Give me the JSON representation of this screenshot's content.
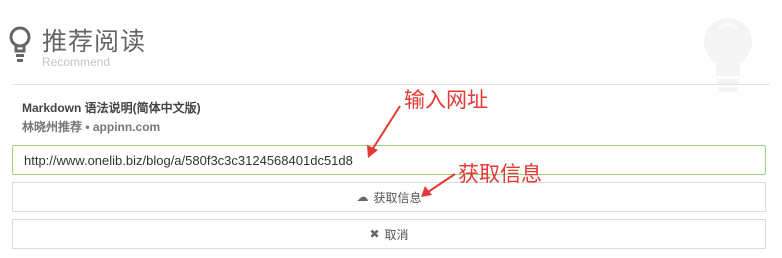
{
  "header": {
    "title": "推荐阅读",
    "subtitle": "Recommend",
    "icon": "lightbulb-icon"
  },
  "article": {
    "title": "Markdown 语法说明(简体中文版)",
    "meta": "林晓州推荐 • appinn.com"
  },
  "url_input": {
    "value": "http://www.onelib.biz/blog/a/580f3c3c3124568401dc51d8"
  },
  "buttons": {
    "fetch_label": "获取信息",
    "fetch_icon": "cloud-download-icon",
    "cancel_label": "取消",
    "cancel_icon": "close-icon"
  },
  "annotations": {
    "enter_url": "输入网址",
    "get_info": "获取信息",
    "color": "#e53935"
  },
  "colors": {
    "input_border": "#9fd27c",
    "title_text": "#666666"
  }
}
